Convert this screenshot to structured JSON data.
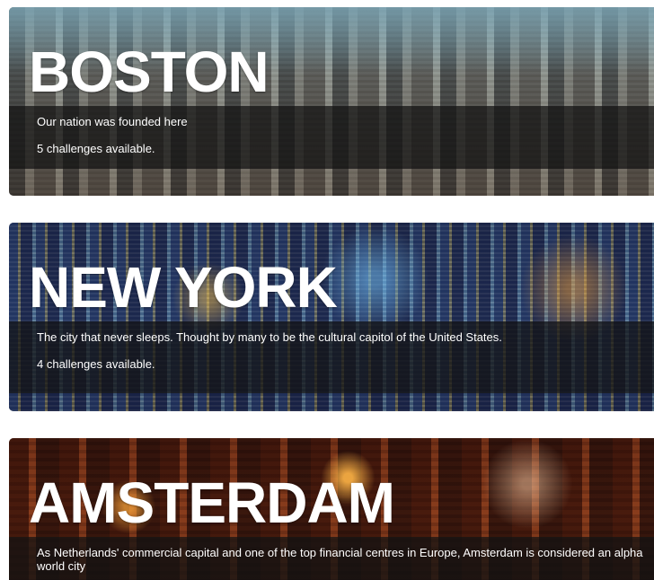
{
  "cities": [
    {
      "name": "BOSTON",
      "description": "Our nation was founded here",
      "challenges": "5 challenges available."
    },
    {
      "name": "NEW YORK",
      "description": "The city that never sleeps. Thought by many to be the cultural capitol of the United States.",
      "challenges": "4 challenges available."
    },
    {
      "name": "AMSTERDAM",
      "description": "As Netherlands' commercial capital and one of the top financial centres in Europe, Amsterdam is considered an alpha world city",
      "challenges": ""
    }
  ]
}
